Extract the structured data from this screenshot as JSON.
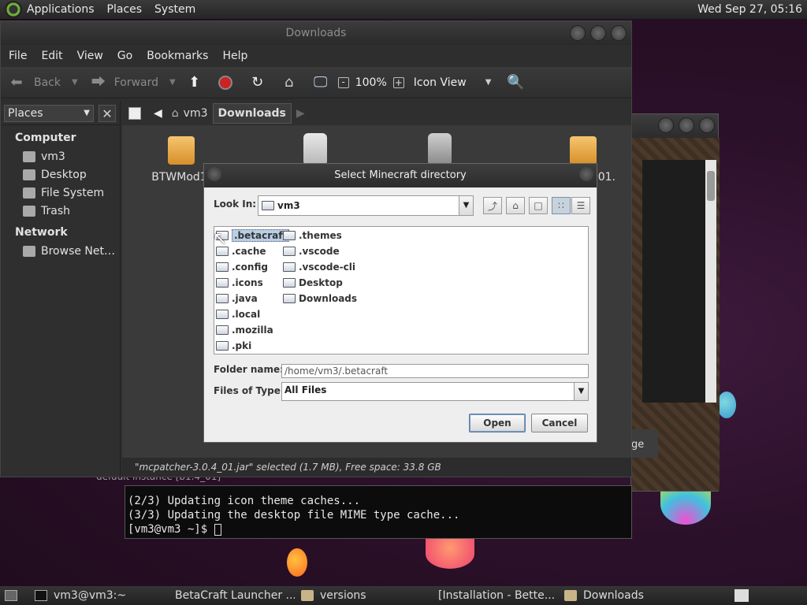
{
  "top_panel": {
    "menus": [
      "Applications",
      "Places",
      "System"
    ],
    "clock": "Wed Sep 27, 05:16"
  },
  "file_manager": {
    "title": "Downloads",
    "menus": [
      "File",
      "Edit",
      "View",
      "Go",
      "Bookmarks",
      "Help"
    ],
    "toolbar": {
      "back": "Back",
      "forward": "Forward",
      "zoom": "100%",
      "view_mode": "Icon View"
    },
    "location": {
      "crumbs": [
        "vm3",
        "Downloads"
      ]
    },
    "sidebar": {
      "selector": "Places",
      "sections": [
        {
          "title": "Computer",
          "items": [
            "vm3",
            "Desktop",
            "File System",
            "Trash"
          ]
        },
        {
          "title": "Network",
          "items": [
            "Browse Net…"
          ]
        }
      ]
    },
    "files": [
      {
        "name": "BTWMod1-",
        "kind": "package"
      },
      {
        "name": "",
        "kind": "jar"
      },
      {
        "name": "",
        "kind": "jar"
      },
      {
        "name": "01.",
        "kind": "package"
      }
    ],
    "status": "\"mcpatcher-3.0.4_01.jar\" selected (1.7 MB), Free space: 33.8 GB"
  },
  "dialog": {
    "title": "Select Minecraft directory",
    "look_in_label": "Look In:",
    "look_in_value": "vm3",
    "folders_col1": [
      ".betacraft",
      ".cache",
      ".config",
      ".icons",
      ".java",
      ".local",
      ".mozilla",
      ".pki"
    ],
    "folders_col2": [
      ".themes",
      ".vscode",
      ".vscode-cli",
      "Desktop",
      "Downloads"
    ],
    "selected_folder": ".betacraft",
    "folder_name_label": "Folder name:",
    "folder_name_value": "/home/vm3/.betacraft",
    "files_of_type_label": "Files of Type:",
    "files_of_type_value": "All Files",
    "open_label": "Open",
    "cancel_label": "Cancel"
  },
  "launcher": {
    "button_partial": "ge",
    "instance_partial": "default instance [b1.4_01]"
  },
  "terminal": {
    "lines": [
      "(2/3) Updating icon theme caches...",
      "(3/3) Updating the desktop file MIME type cache...",
      "[vm3@vm3 ~]$ "
    ]
  },
  "taskbar": {
    "items": [
      "vm3@vm3:~",
      "BetaCraft Launcher ...",
      "versions",
      "[Installation - Bette...",
      "Downloads"
    ]
  },
  "colors": {
    "accent_selection": "#b8cfe5",
    "record_red": "#cc2222",
    "package_orange": "#e6a548"
  }
}
